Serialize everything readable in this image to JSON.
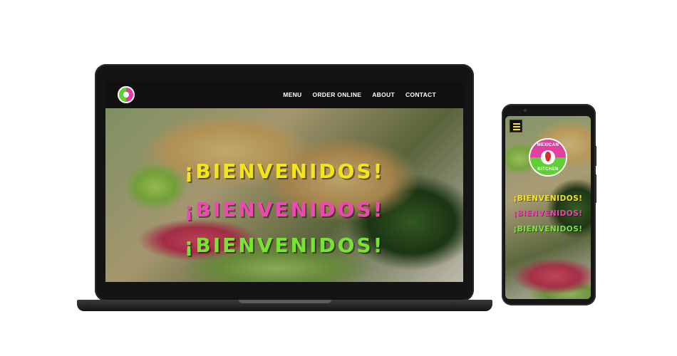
{
  "nav": {
    "items": [
      {
        "label": "MENU"
      },
      {
        "label": "ORDER ONLINE"
      },
      {
        "label": "ABOUT"
      },
      {
        "label": "CONTACT"
      }
    ]
  },
  "hero": {
    "headlines": [
      {
        "text": "¡BIENVENIDOS!",
        "color": "#f2e422"
      },
      {
        "text": "¡BIENVENIDOS!",
        "color": "#e84ab0"
      },
      {
        "text": "¡BIENVENIDOS!",
        "color": "#7ae23a"
      }
    ]
  },
  "logo": {
    "top_text": "MEXICAN",
    "bottom_text": "KITCHEN",
    "icon": "chili-pepper-icon"
  },
  "icons": {
    "menu": "hamburger-menu-icon"
  },
  "colors": {
    "brand_pink": "#e0409f",
    "brand_green": "#5fd033",
    "brand_yellow": "#f2e422",
    "nav_background": "#111111"
  }
}
